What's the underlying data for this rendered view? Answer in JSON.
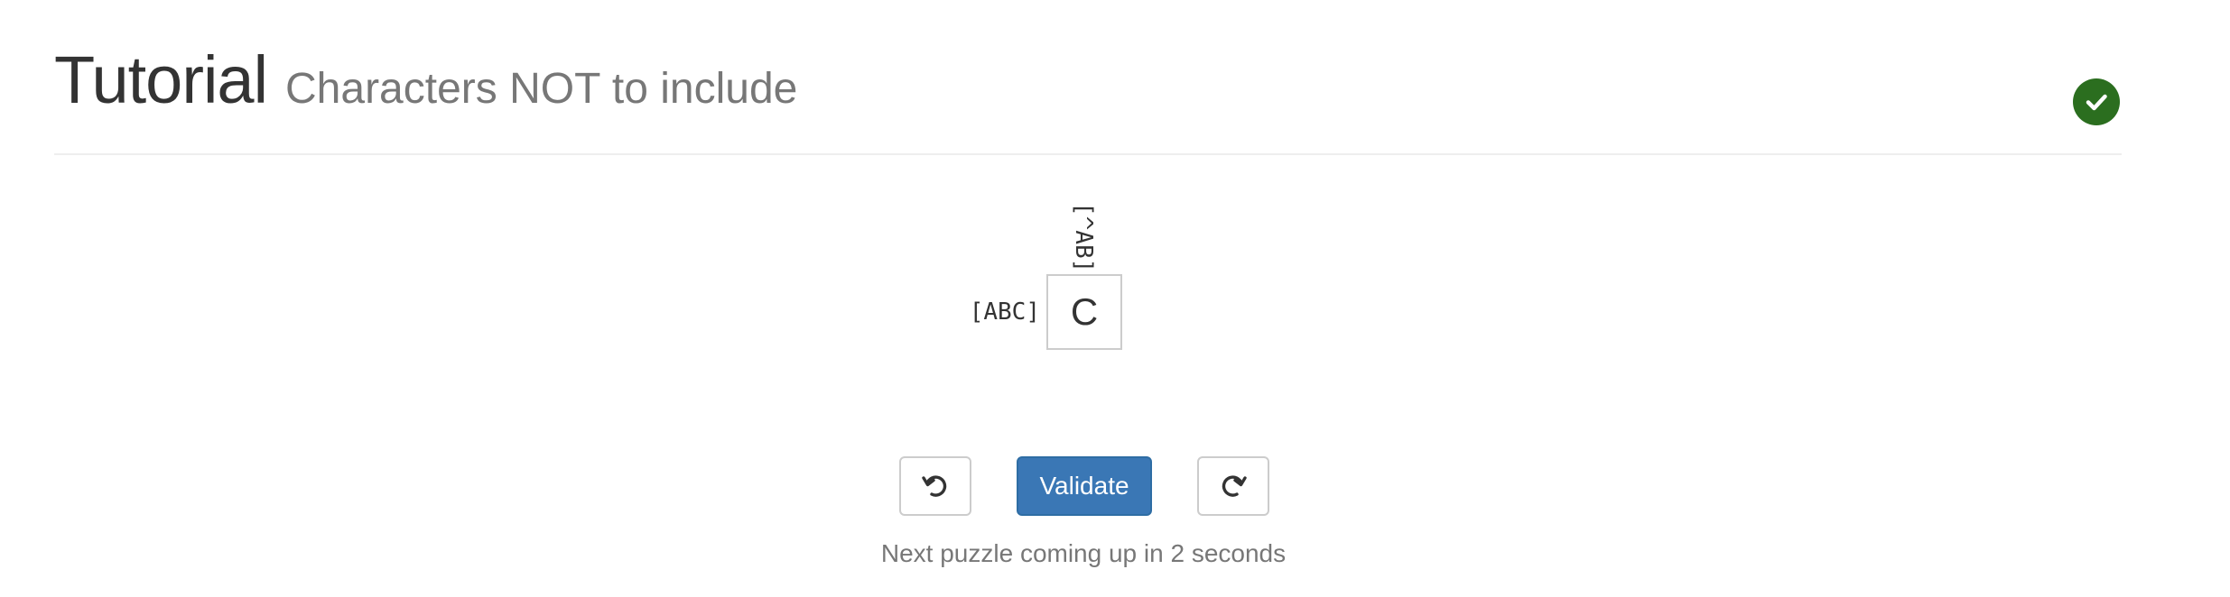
{
  "header": {
    "title": "Tutorial",
    "subtitle": "Characters NOT to include",
    "status_icon": "check-circle-icon",
    "status_color": "#2b6e1f"
  },
  "puzzle": {
    "column_clues": [
      "[^AB]"
    ],
    "row_clues": [
      "[ABC]"
    ],
    "cells": [
      [
        "C"
      ]
    ]
  },
  "controls": {
    "undo_icon": "undo-icon",
    "validate_label": "Validate",
    "redo_icon": "redo-icon",
    "accent_color": "#3a77b5"
  },
  "status_message": "Next puzzle coming up in 2 seconds"
}
